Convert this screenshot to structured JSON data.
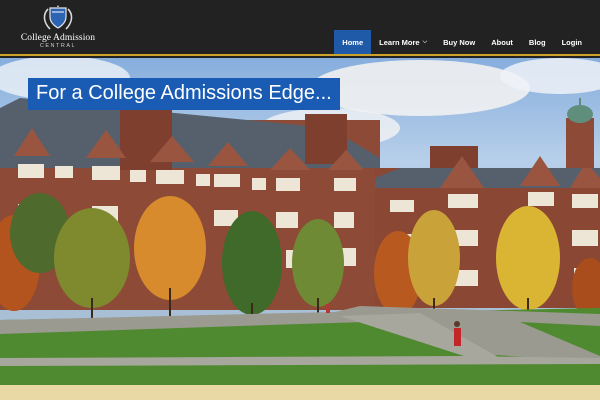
{
  "logo": {
    "name": "College Admission",
    "sub": "CENTRAL"
  },
  "nav": {
    "items": [
      {
        "label": "Home",
        "active": true
      },
      {
        "label": "Learn More",
        "dropdown": true
      },
      {
        "label": "Buy Now"
      },
      {
        "label": "About"
      },
      {
        "label": "Blog"
      },
      {
        "label": "Login"
      }
    ]
  },
  "hero": {
    "title": "For a College Admissions Edge..."
  },
  "colors": {
    "header_bg": "#222222",
    "accent_gold": "#c9a227",
    "nav_active": "#1e5aa8",
    "title_bg": "#1a5bb3"
  },
  "icons": {
    "logo": "shield-laurel-icon",
    "learn_more_dropdown": "chevron-down-icon"
  }
}
